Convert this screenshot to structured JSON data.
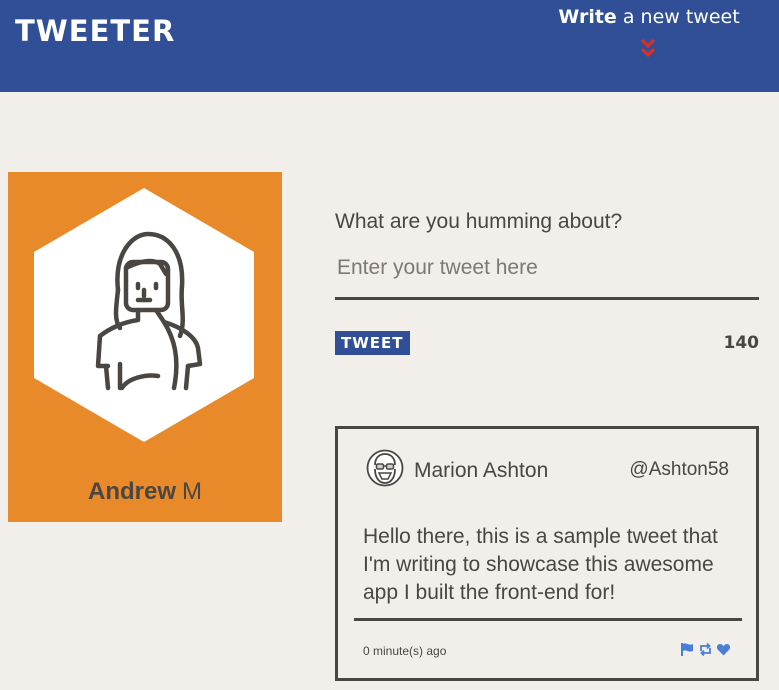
{
  "header": {
    "brand": "TWEETER",
    "compose_bold": "Write",
    "compose_rest": " a new tweet",
    "chevron_icon": "double-chevron-down-icon",
    "background": "#304f96",
    "chevron_color": "#d9302c"
  },
  "profile": {
    "first_name": "Andrew",
    "last_name": "M",
    "avatar_icon": "woman-avatar-icon",
    "card_color": "#e8892a"
  },
  "composer": {
    "label": "What are you humming about?",
    "placeholder": "Enter your tweet here",
    "value": "",
    "tweet_button": "TWEET",
    "char_count": "140"
  },
  "tweets": [
    {
      "author": "Marion Ashton",
      "handle": "@Ashton58",
      "avatar_icon": "bearded-man-glasses-avatar-icon",
      "body": "Hello there, this is a sample tweet that I'm writing to showcase this awesome app I built the front-end for!",
      "time": "0 minute(s) ago",
      "actions": [
        "flag-icon",
        "retweet-icon",
        "heart-icon"
      ],
      "action_color": "#4a7fd6"
    }
  ]
}
